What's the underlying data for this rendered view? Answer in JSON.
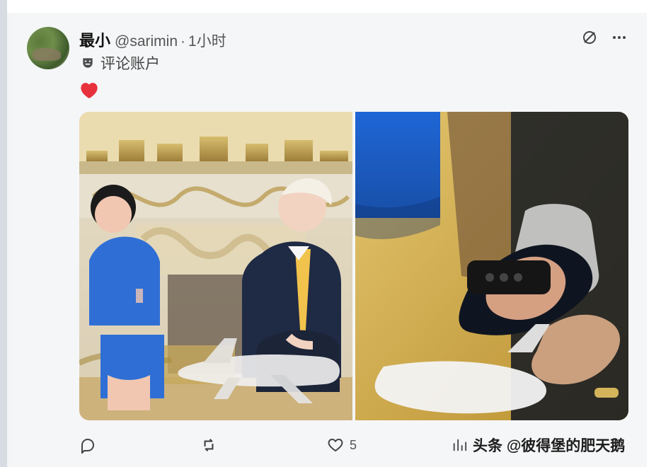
{
  "post": {
    "display_name": "最小",
    "handle": "@sarimin",
    "separator": "·",
    "time": "1小时",
    "label": "评论账户",
    "emoji": "heart"
  },
  "actions": {
    "reply_count": "",
    "repost_count": "",
    "like_count": "5"
  },
  "watermark": {
    "text": "头条 @彼得堡的肥天鹅"
  },
  "icons": {
    "avatar": "avatar",
    "label": "mask-icon",
    "top_actions": [
      "ghost-icon",
      "more-icon"
    ],
    "bottom_actions": [
      "reply-icon",
      "repost-icon",
      "like-icon"
    ],
    "watermark": "stats-icon"
  },
  "colors": {
    "background": "#f5f6f7",
    "text": "#111111",
    "muted": "#555555",
    "heart": "#e7323d"
  }
}
